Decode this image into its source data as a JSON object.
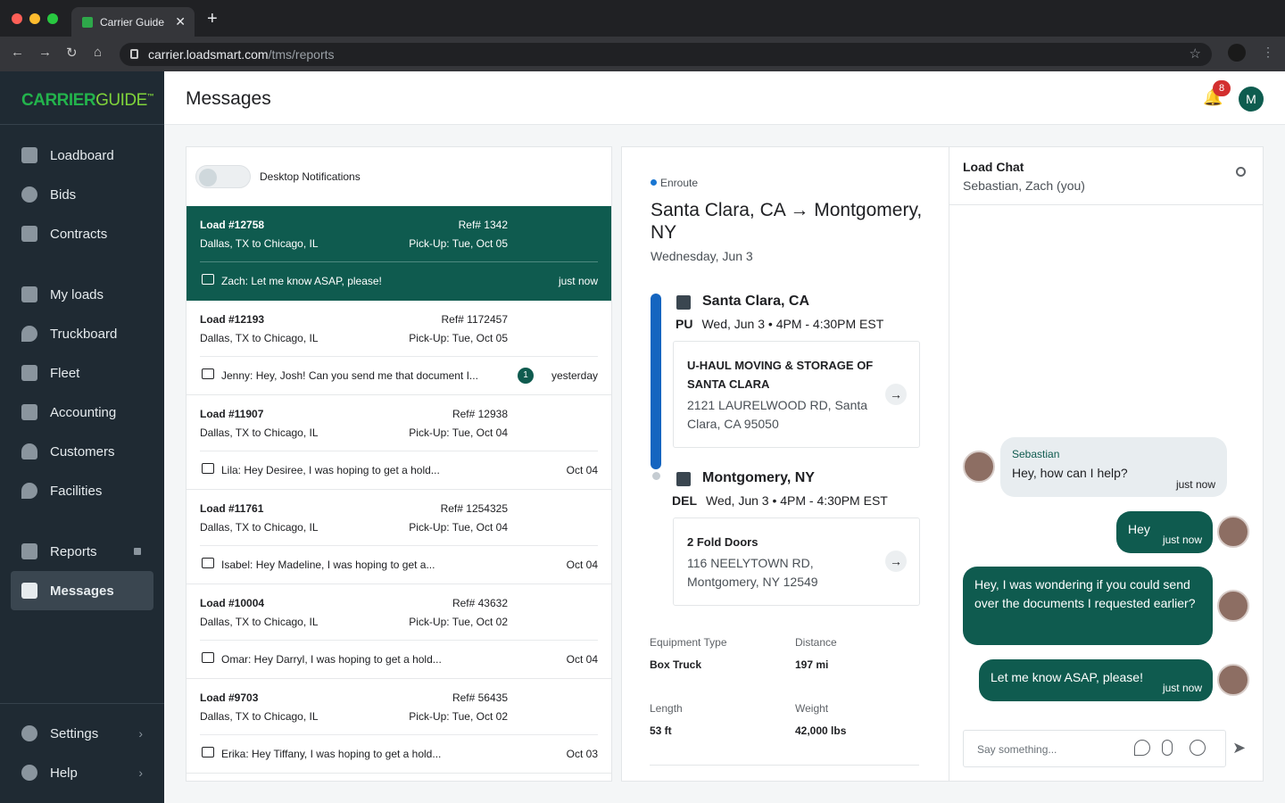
{
  "browser": {
    "tab_title": "Carrier Guide",
    "url_host": "carrier.loadsmart.com",
    "url_path": "/tms/reports"
  },
  "sidebar": {
    "logo_main": "CARRIER",
    "logo_sub": "GUIDE",
    "logo_tm": "™",
    "items": [
      {
        "label": "Loadboard",
        "icon": "loadboard-icon"
      },
      {
        "label": "Bids",
        "icon": "bids-icon"
      },
      {
        "label": "Contracts",
        "icon": "contracts-icon"
      },
      {
        "label": "My loads",
        "icon": "my-loads-icon"
      },
      {
        "label": "Truckboard",
        "icon": "truckboard-icon"
      },
      {
        "label": "Fleet",
        "icon": "fleet-icon"
      },
      {
        "label": "Accounting",
        "icon": "accounting-icon"
      },
      {
        "label": "Customers",
        "icon": "customers-icon"
      },
      {
        "label": "Facilities",
        "icon": "facilities-icon"
      },
      {
        "label": "Reports",
        "icon": "reports-icon"
      },
      {
        "label": "Messages",
        "icon": "messages-icon"
      },
      {
        "label": "Settings",
        "icon": "settings-icon"
      },
      {
        "label": "Help",
        "icon": "help-icon"
      }
    ],
    "active_item": "Messages"
  },
  "header": {
    "title": "Messages",
    "notification_count": "8",
    "user_initial": "M"
  },
  "conversations": {
    "notifications_label": "Desktop Notifications",
    "notifications_enabled": false,
    "items": [
      {
        "load": "Load #12758",
        "ref": "Ref# 1342",
        "route": "Dallas, TX to Chicago, IL",
        "pickup": "Pick-Up: Tue, Oct 05",
        "message": "Zach: Let me know ASAP, please!",
        "time": "just now",
        "unread": "",
        "selected": true
      },
      {
        "load": "Load #12193",
        "ref": "Ref# 1172457",
        "route": "Dallas, TX to Chicago, IL",
        "pickup": "Pick-Up: Tue, Oct 05",
        "message": "Jenny: Hey, Josh! Can you send me that document I...",
        "time": "yesterday",
        "unread": "1"
      },
      {
        "load": "Load #11907",
        "ref": "Ref# 12938",
        "route": "Dallas, TX to Chicago, IL",
        "pickup": "Pick-Up: Tue, Oct 04",
        "message": "Lila: Hey Desiree, I was hoping to get a hold...",
        "time": "Oct 04",
        "unread": ""
      },
      {
        "load": "Load #11761",
        "ref": "Ref# 1254325",
        "route": "Dallas, TX to Chicago, IL",
        "pickup": "Pick-Up: Tue, Oct 04",
        "message": "Isabel: Hey Madeline, I was hoping to get a...",
        "time": "Oct 04",
        "unread": ""
      },
      {
        "load": "Load #10004",
        "ref": "Ref# 43632",
        "route": "Dallas, TX to Chicago, IL",
        "pickup": "Pick-Up: Tue, Oct 02",
        "message": "Omar: Hey Darryl, I was hoping to get a hold...",
        "time": "Oct 04",
        "unread": ""
      },
      {
        "load": "Load #9703",
        "ref": "Ref# 56435",
        "route": "Dallas, TX to Chicago, IL",
        "pickup": "Pick-Up: Tue, Oct 02",
        "message": "Erika: Hey Tiffany, I was hoping to get a hold...",
        "time": "Oct 03",
        "unread": ""
      }
    ]
  },
  "load_detail": {
    "status": "Enroute",
    "title": "Santa Clara, CA → Montgomery, NY",
    "date": "Wednesday, Jun 3",
    "pickup": {
      "city": "Santa Clara, CA",
      "type": "PU",
      "time": "Wed, Jun 3 • 4PM - 4:30PM EST",
      "facility": "U-HAUL MOVING & STORAGE OF SANTA CLARA",
      "address": "2121 LAURELWOOD RD, Santa Clara, CA 95050"
    },
    "delivery": {
      "city": "Montgomery, NY",
      "type": "DEL",
      "time": "Wed, Jun 3 • 4PM - 4:30PM EST",
      "facility": "2 Fold Doors",
      "address": "116 NEELYTOWN RD, Montgomery, NY 12549"
    },
    "details": {
      "equipment_label": "Equipment Type",
      "equipment": "Box Truck",
      "distance_label": "Distance",
      "distance": "197 mi",
      "length_label": "Length",
      "length": "53 ft",
      "weight_label": "Weight",
      "weight": "42,000 lbs"
    }
  },
  "chat": {
    "title": "Load Chat",
    "participants": "Sebastian, Zach (you)",
    "messages": [
      {
        "from": "Sebastian",
        "text": "Hey, how can I help?",
        "time": "just now",
        "direction": "in"
      },
      {
        "from": "",
        "text": "Hey",
        "time": "just now",
        "direction": "out"
      },
      {
        "from": "",
        "text": "Hey, I was wondering if you could send over the documents I requested earlier?",
        "time": "",
        "direction": "out"
      },
      {
        "from": "",
        "text": "Let me know ASAP, please!",
        "time": "just now",
        "direction": "out"
      }
    ],
    "input_placeholder": "Say something...",
    "accent_color": "#0f5b4f"
  }
}
